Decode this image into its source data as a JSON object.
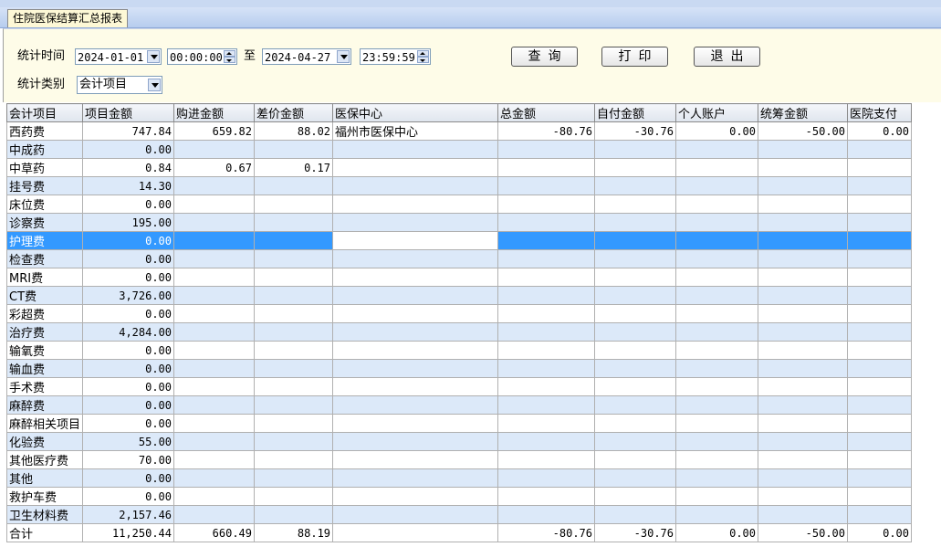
{
  "tab": {
    "label": "住院医保结算汇总报表"
  },
  "filters": {
    "time_label": "统计时间",
    "start_date": "2024-01-01",
    "start_time": "00:00:00",
    "to_label": "至",
    "end_date": "2024-04-27",
    "end_time": "23:59:59",
    "type_label": "统计类别",
    "type_value": "会计项目"
  },
  "buttons": {
    "query": "查询",
    "print": "打印",
    "exit": "退出"
  },
  "table": {
    "columns": [
      "会计项目",
      "项目金额",
      "购进金额",
      "差价金额",
      "医保中心",
      "总金额",
      "自付金额",
      "个人账户",
      "统筹金额",
      "医院支付"
    ],
    "rows": [
      [
        "西药费",
        "747.84",
        "659.82",
        "88.02",
        "福州市医保中心",
        "-80.76",
        "-30.76",
        "0.00",
        "-50.00",
        "0.00"
      ],
      [
        "中成药",
        "0.00",
        "",
        "",
        "",
        "",
        "",
        "",
        "",
        ""
      ],
      [
        "中草药",
        "0.84",
        "0.67",
        "0.17",
        "",
        "",
        "",
        "",
        "",
        ""
      ],
      [
        "挂号费",
        "14.30",
        "",
        "",
        "",
        "",
        "",
        "",
        "",
        ""
      ],
      [
        "床位费",
        "0.00",
        "",
        "",
        "",
        "",
        "",
        "",
        "",
        ""
      ],
      [
        "诊察费",
        "195.00",
        "",
        "",
        "",
        "",
        "",
        "",
        "",
        ""
      ],
      [
        "护理费",
        "0.00",
        "",
        "",
        "",
        "",
        "",
        "",
        "",
        ""
      ],
      [
        "检查费",
        "0.00",
        "",
        "",
        "",
        "",
        "",
        "",
        "",
        ""
      ],
      [
        "MRI费",
        "0.00",
        "",
        "",
        "",
        "",
        "",
        "",
        "",
        ""
      ],
      [
        "CT费",
        "3,726.00",
        "",
        "",
        "",
        "",
        "",
        "",
        "",
        ""
      ],
      [
        "彩超费",
        "0.00",
        "",
        "",
        "",
        "",
        "",
        "",
        "",
        ""
      ],
      [
        "治疗费",
        "4,284.00",
        "",
        "",
        "",
        "",
        "",
        "",
        "",
        ""
      ],
      [
        "输氧费",
        "0.00",
        "",
        "",
        "",
        "",
        "",
        "",
        "",
        ""
      ],
      [
        "输血费",
        "0.00",
        "",
        "",
        "",
        "",
        "",
        "",
        "",
        ""
      ],
      [
        "手术费",
        "0.00",
        "",
        "",
        "",
        "",
        "",
        "",
        "",
        ""
      ],
      [
        "麻醉费",
        "0.00",
        "",
        "",
        "",
        "",
        "",
        "",
        "",
        ""
      ],
      [
        "麻醉相关项目",
        "0.00",
        "",
        "",
        "",
        "",
        "",
        "",
        "",
        ""
      ],
      [
        "化验费",
        "55.00",
        "",
        "",
        "",
        "",
        "",
        "",
        "",
        ""
      ],
      [
        "其他医疗费",
        "70.00",
        "",
        "",
        "",
        "",
        "",
        "",
        "",
        ""
      ],
      [
        "其他",
        "0.00",
        "",
        "",
        "",
        "",
        "",
        "",
        "",
        ""
      ],
      [
        "救护车费",
        "0.00",
        "",
        "",
        "",
        "",
        "",
        "",
        "",
        ""
      ],
      [
        "卫生材料费",
        "2,157.46",
        "",
        "",
        "",
        "",
        "",
        "",
        "",
        ""
      ]
    ],
    "total": [
      "合计",
      "11,250.44",
      "660.49",
      "88.19",
      "",
      "-80.76",
      "-30.76",
      "0.00",
      "-50.00",
      "0.00"
    ],
    "selected_row": 6
  },
  "colors": {
    "selection": "#3399ff",
    "alt_row": "#dce9f9",
    "panel": "#fefce8"
  }
}
